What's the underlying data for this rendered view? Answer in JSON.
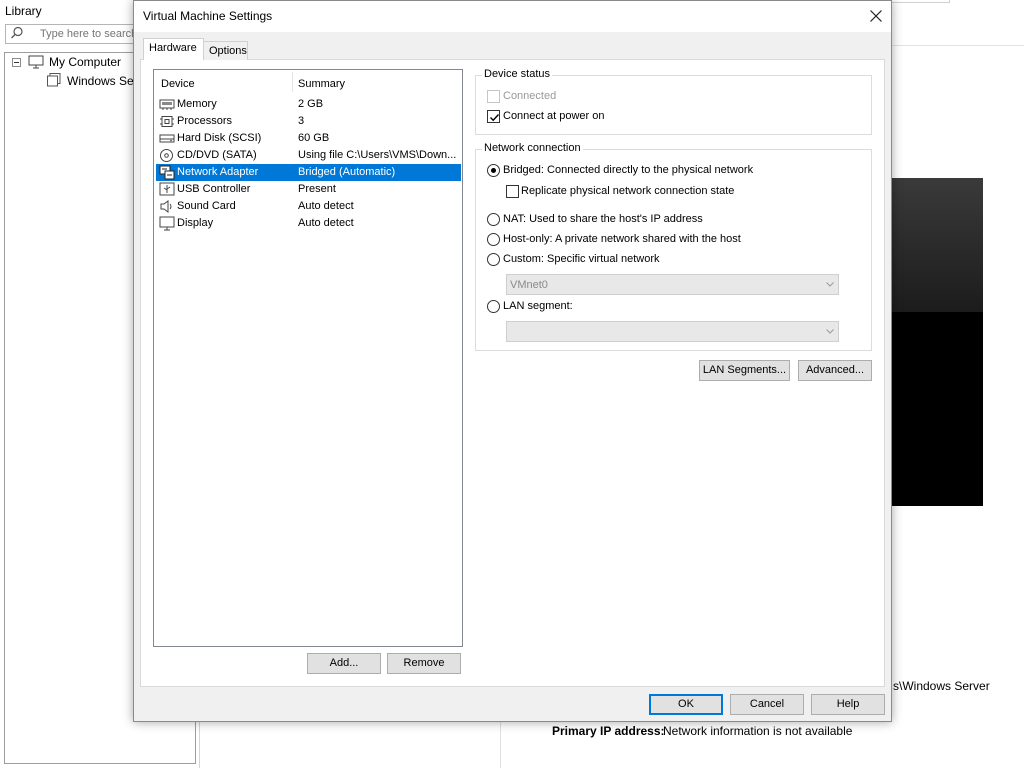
{
  "library": {
    "title": "Library",
    "search_placeholder": "Type here to search",
    "tree": {
      "root_label": "My Computer",
      "vm_label": "Windows Server"
    }
  },
  "vm_summary": {
    "path_text": "s\\Windows Server",
    "primary_ip_label": "Primary IP address:",
    "primary_ip_value": "Network information is not available"
  },
  "dialog": {
    "title": "Virtual Machine Settings",
    "tabs": [
      {
        "label": "Hardware",
        "active": true
      },
      {
        "label": "Options",
        "active": false
      }
    ],
    "device_list": {
      "columns": [
        "Device",
        "Summary"
      ],
      "devices": [
        {
          "icon": "memory-icon",
          "name": "Memory",
          "summary": "2 GB",
          "selected": false
        },
        {
          "icon": "processor-icon",
          "name": "Processors",
          "summary": "3",
          "selected": false
        },
        {
          "icon": "hard-disk-icon",
          "name": "Hard Disk (SCSI)",
          "summary": "60 GB",
          "selected": false
        },
        {
          "icon": "cd-dvd-icon",
          "name": "CD/DVD (SATA)",
          "summary": "Using file C:\\Users\\VMS\\Down...",
          "selected": false
        },
        {
          "icon": "network-adapter-icon",
          "name": "Network Adapter",
          "summary": "Bridged (Automatic)",
          "selected": true
        },
        {
          "icon": "usb-icon",
          "name": "USB Controller",
          "summary": "Present",
          "selected": false
        },
        {
          "icon": "sound-card-icon",
          "name": "Sound Card",
          "summary": "Auto detect",
          "selected": false
        },
        {
          "icon": "display-icon",
          "name": "Display",
          "summary": "Auto detect",
          "selected": false
        }
      ],
      "add_label": "Add...",
      "remove_label": "Remove"
    },
    "device_status": {
      "title": "Device status",
      "connected_label": "Connected",
      "connected_checked": false,
      "connected_enabled": false,
      "power_on_label": "Connect at power on",
      "power_on_checked": true
    },
    "network_connection": {
      "title": "Network connection",
      "bridged_label": "Bridged: Connected directly to the physical network",
      "replicate_label": "Replicate physical network connection state",
      "nat_label": "NAT: Used to share the host's IP address",
      "host_only_label": "Host-only: A private network shared with the host",
      "custom_label": "Custom: Specific virtual network",
      "custom_value": "VMnet0",
      "lan_label": "LAN segment:",
      "lan_value": "",
      "selected": "bridged"
    },
    "lan_segments_label": "LAN Segments...",
    "advanced_label": "Advanced...",
    "footer": {
      "ok_label": "OK",
      "cancel_label": "Cancel",
      "help_label": "Help"
    }
  }
}
